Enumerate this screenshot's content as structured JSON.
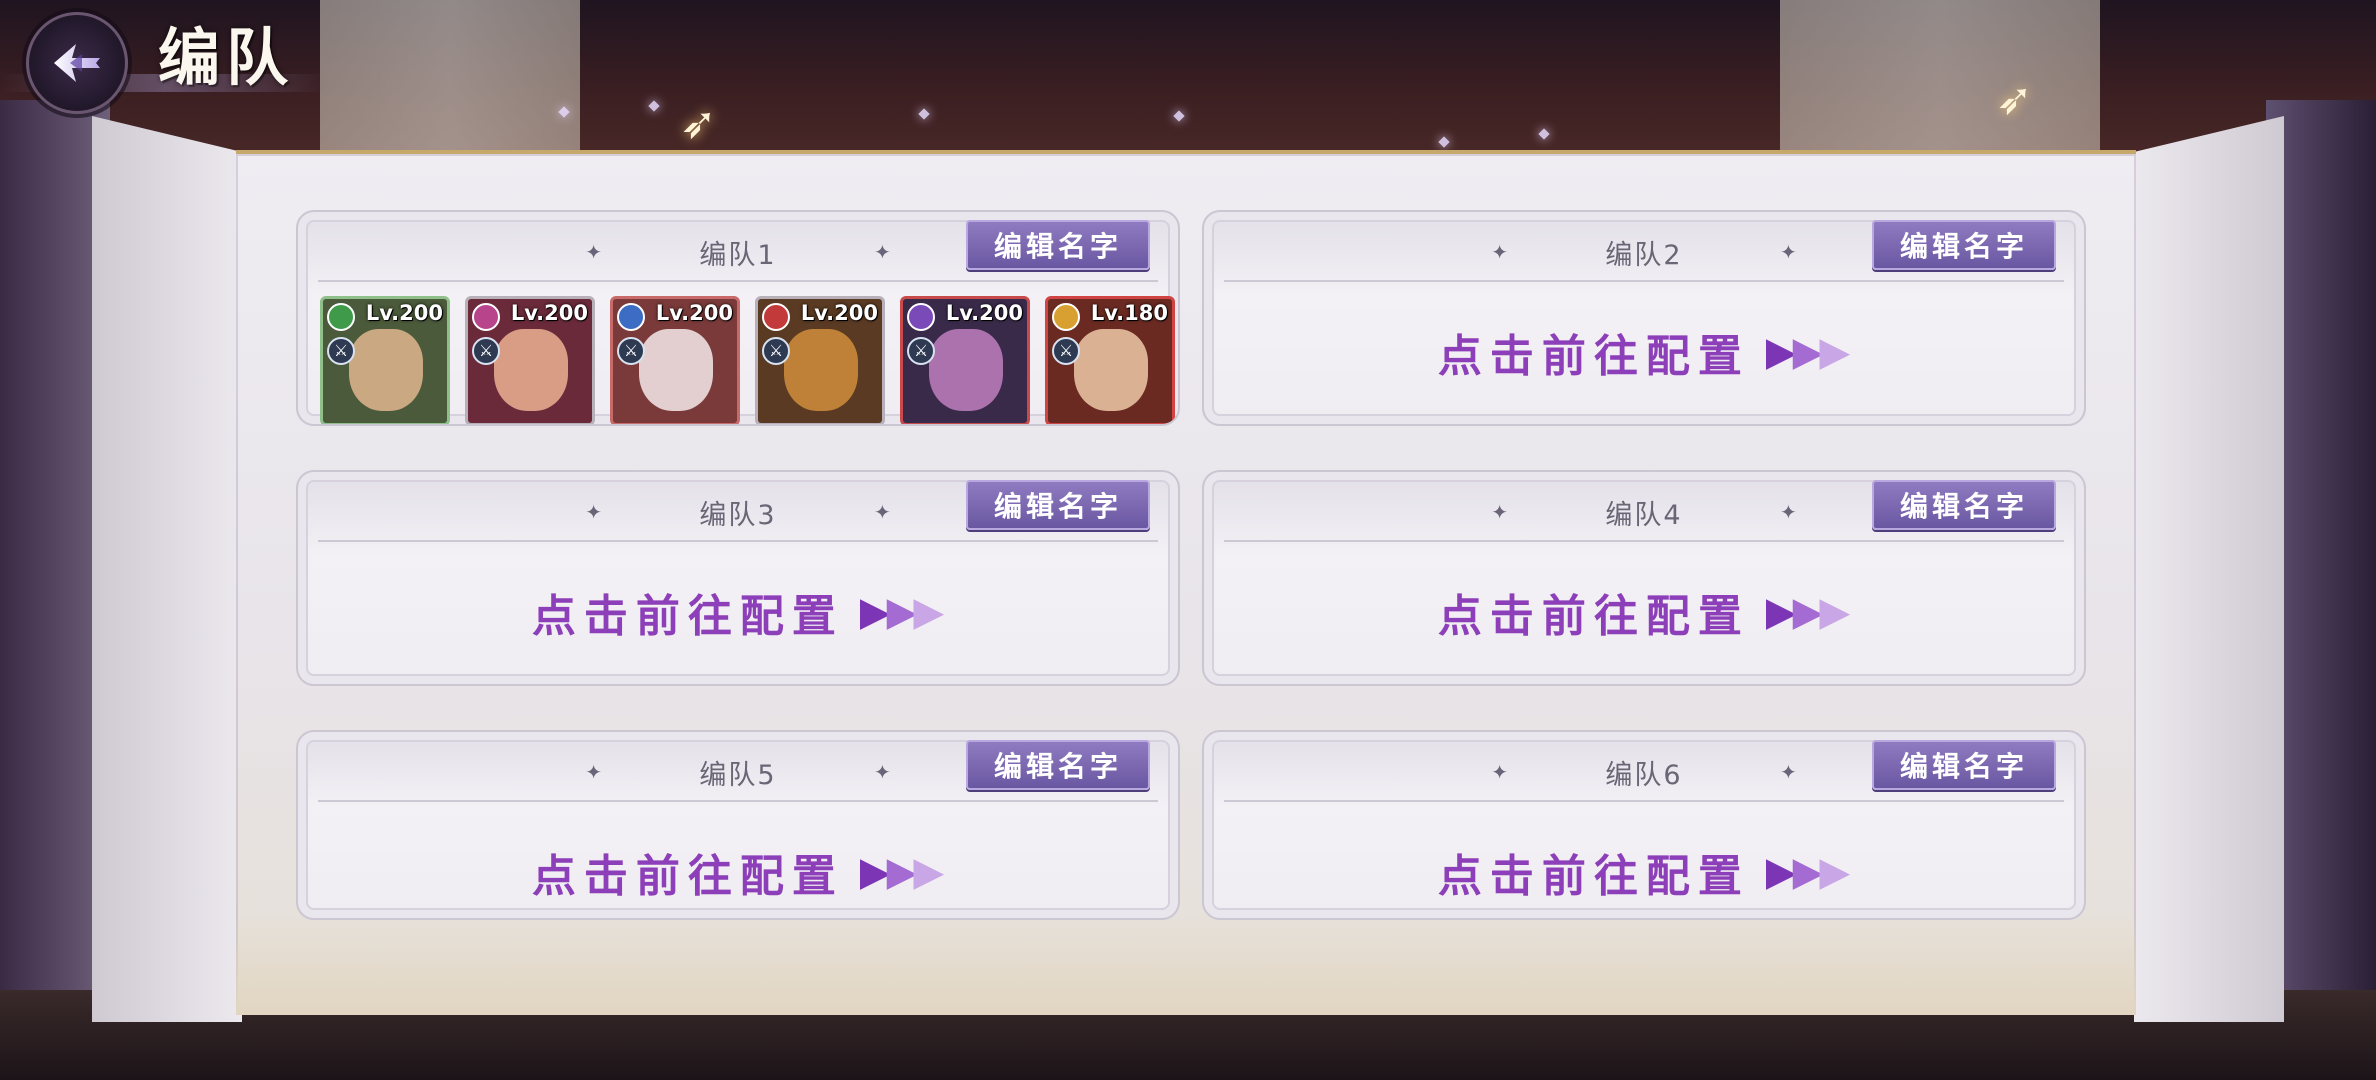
{
  "header": {
    "title": "编队"
  },
  "edit_label": "编辑名字",
  "config_label": "点击前往配置",
  "teams": [
    {
      "name": "编队1",
      "heroes": [
        {
          "level": "Lv.200",
          "element_color": "#3f9a4a",
          "frame_color": "#8fc08a",
          "bg": "#4a5a3a",
          "face": "#d8b08a"
        },
        {
          "level": "Lv.200",
          "element_color": "#b8458c",
          "frame_color": "#b8b0b8",
          "bg": "#6a2a3a",
          "face": "#e6a88e"
        },
        {
          "level": "Lv.200",
          "element_color": "#3d6cc4",
          "frame_color": "#c86a6a",
          "bg": "#7a3a3a",
          "face": "#eee0e0"
        },
        {
          "level": "Lv.200",
          "element_color": "#c23a3a",
          "frame_color": "#b8b0b8",
          "bg": "#5a3a22",
          "face": "#c98a3a"
        },
        {
          "level": "Lv.200",
          "element_color": "#7a4ab8",
          "frame_color": "#c84a4a",
          "bg": "#3a2a4a",
          "face": "#b87ab8"
        },
        {
          "level": "Lv.180",
          "element_color": "#d8a030",
          "frame_color": "#d04444",
          "bg": "#6a2a22",
          "face": "#e8c0a0"
        }
      ]
    },
    {
      "name": "编队2",
      "heroes": []
    },
    {
      "name": "编队3",
      "heroes": []
    },
    {
      "name": "编队4",
      "heroes": []
    },
    {
      "name": "编队5",
      "heroes": []
    },
    {
      "name": "编队6",
      "heroes": []
    }
  ],
  "icons": {
    "back": "back-arrow-icon",
    "star": "sparkle-star-icon",
    "arrow": "triple-chevron-right-icon"
  },
  "colors": {
    "accent_purple": "#8c3fb8",
    "edit_button": "#6a57a2",
    "panel": "#efedf2"
  }
}
